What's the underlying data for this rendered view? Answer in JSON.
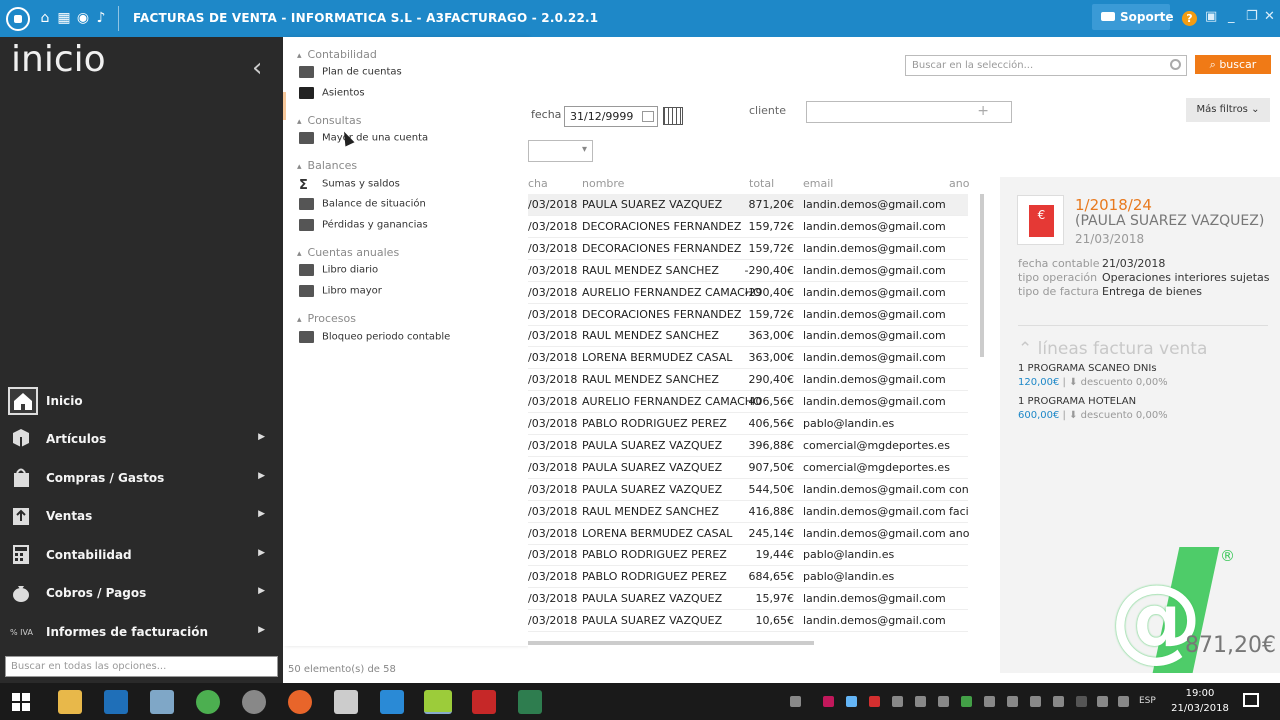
{
  "titlebar": {
    "title": "FACTURAS DE VENTA  - INFORMATICA S.L  - A3FACTURAGO - 2.0.22.1",
    "soporte": "Soporte",
    "help": "?",
    "accent": "#1e88c8"
  },
  "sidebar": {
    "title": "inicio",
    "collapse_icon": "chevron-left-icon",
    "items": [
      {
        "label": "Inicio",
        "icon": "home-icon"
      },
      {
        "label": "Artículos",
        "icon": "box-icon"
      },
      {
        "label": "Compras / Gastos",
        "icon": "shopping-bag-icon"
      },
      {
        "label": "Ventas",
        "icon": "upload-box-icon"
      },
      {
        "label": "Contabilidad",
        "icon": "calculator-icon"
      },
      {
        "label": "Cobros / Pagos",
        "icon": "money-bag-icon"
      },
      {
        "label": "Informes de facturación",
        "icon": "percent-iva-icon",
        "icon_text": "% IVA"
      }
    ],
    "search_placeholder": "Buscar en todas las opciones..."
  },
  "submenu": {
    "groups": [
      {
        "title": "Contabilidad",
        "items": [
          "Plan de cuentas",
          "Asientos"
        ]
      },
      {
        "title": "Consultas",
        "items": [
          "Mayor de una cuenta"
        ]
      },
      {
        "title": "Balances",
        "items": [
          "Sumas y saldos",
          "Balance de situación",
          "Pérdidas y ganancias"
        ]
      },
      {
        "title": "Cuentas anuales",
        "items": [
          "Libro diario",
          "Libro mayor"
        ]
      },
      {
        "title": "Procesos",
        "items": [
          "Bloqueo periodo contable"
        ]
      }
    ]
  },
  "filters": {
    "search_placeholder": "Buscar en la selección...",
    "buscar": "buscar",
    "fecha_label": "fecha",
    "fecha_value": "31/12/9999",
    "cliente_label": "cliente",
    "mas_filtros": "Más filtros"
  },
  "table": {
    "headers": {
      "date": "cha",
      "name": "nombre",
      "total": "total",
      "email": "email",
      "ano": "ano"
    },
    "rows": [
      {
        "date": "/03/2018",
        "name": "PAULA SUAREZ VAZQUEZ",
        "total": "871,20€",
        "email": "landin.demos@gmail.com",
        "ano": ""
      },
      {
        "date": "/03/2018",
        "name": "DECORACIONES FERNANDEZ",
        "total": "159,72€",
        "email": "landin.demos@gmail.com",
        "ano": ""
      },
      {
        "date": "/03/2018",
        "name": "DECORACIONES FERNANDEZ",
        "total": "159,72€",
        "email": "landin.demos@gmail.com",
        "ano": ""
      },
      {
        "date": "/03/2018",
        "name": "RAUL MENDEZ SANCHEZ",
        "total": "-290,40€",
        "email": "landin.demos@gmail.com",
        "ano": ""
      },
      {
        "date": "/03/2018",
        "name": "AURELIO FERNANDEZ CAMACHO",
        "total": "-290,40€",
        "email": "landin.demos@gmail.com",
        "ano": ""
      },
      {
        "date": "/03/2018",
        "name": "DECORACIONES FERNANDEZ",
        "total": "159,72€",
        "email": "landin.demos@gmail.com",
        "ano": ""
      },
      {
        "date": "/03/2018",
        "name": "RAUL MENDEZ SANCHEZ",
        "total": "363,00€",
        "email": "landin.demos@gmail.com",
        "ano": ""
      },
      {
        "date": "/03/2018",
        "name": "LORENA BERMUDEZ CASAL",
        "total": "363,00€",
        "email": "landin.demos@gmail.com",
        "ano": ""
      },
      {
        "date": "/03/2018",
        "name": "RAUL MENDEZ SANCHEZ",
        "total": "290,40€",
        "email": "landin.demos@gmail.com",
        "ano": ""
      },
      {
        "date": "/03/2018",
        "name": "AURELIO FERNANDEZ CAMACHO",
        "total": "406,56€",
        "email": "landin.demos@gmail.com",
        "ano": ""
      },
      {
        "date": "/03/2018",
        "name": "PABLO RODRIGUEZ PEREZ",
        "total": "406,56€",
        "email": "pablo@landin.es",
        "ano": ""
      },
      {
        "date": "/03/2018",
        "name": "PAULA SUAREZ VAZQUEZ",
        "total": "396,88€",
        "email": "comercial@mgdeportes.es",
        "ano": ""
      },
      {
        "date": "/03/2018",
        "name": "PAULA SUAREZ VAZQUEZ",
        "total": "907,50€",
        "email": "comercial@mgdeportes.es",
        "ano": ""
      },
      {
        "date": "/03/2018",
        "name": "PAULA SUAREZ VAZQUEZ",
        "total": "544,50€",
        "email": "landin.demos@gmail.com",
        "ano": "con"
      },
      {
        "date": "/03/2018",
        "name": "RAUL MENDEZ SANCHEZ",
        "total": "416,88€",
        "email": "landin.demos@gmail.com",
        "ano": "faci"
      },
      {
        "date": "/03/2018",
        "name": "LORENA BERMUDEZ CASAL",
        "total": "245,14€",
        "email": "landin.demos@gmail.com",
        "ano": "ano"
      },
      {
        "date": "/03/2018",
        "name": "PABLO RODRIGUEZ PEREZ",
        "total": "19,44€",
        "email": "pablo@landin.es",
        "ano": ""
      },
      {
        "date": "/03/2018",
        "name": "PABLO RODRIGUEZ PEREZ",
        "total": "684,65€",
        "email": "pablo@landin.es",
        "ano": ""
      },
      {
        "date": "/03/2018",
        "name": "PAULA SUAREZ VAZQUEZ",
        "total": "15,97€",
        "email": "landin.demos@gmail.com",
        "ano": ""
      },
      {
        "date": "/03/2018",
        "name": "PAULA SUAREZ VAZQUEZ",
        "total": "10,65€",
        "email": "landin.demos@gmail.com",
        "ano": ""
      }
    ],
    "count": "50 elemento(s) de 58"
  },
  "detail": {
    "number": "1/2018/24",
    "client": "(PAULA SUAREZ VAZQUEZ)",
    "date": "21/03/2018",
    "fields": [
      {
        "k": "fecha contable",
        "v": "21/03/2018"
      },
      {
        "k": "tipo operación",
        "v": "Operaciones interiores sujetas"
      },
      {
        "k": "tipo de factura",
        "v": "Entrega de bienes"
      }
    ],
    "lineas_title": "líneas factura venta",
    "lines": [
      {
        "name": "1 PROGRAMA SCANEO DNIs",
        "price": "120,00€",
        "discount": "descuento 0,00%"
      },
      {
        "name": "1 PROGRAMA HOTELAN",
        "price": "600,00€",
        "discount": "descuento 0,00%"
      }
    ],
    "total": "871,20€",
    "registered": "®"
  },
  "taskbar": {
    "lang": "ESP",
    "time": "19:00",
    "date": "21/03/2018"
  }
}
